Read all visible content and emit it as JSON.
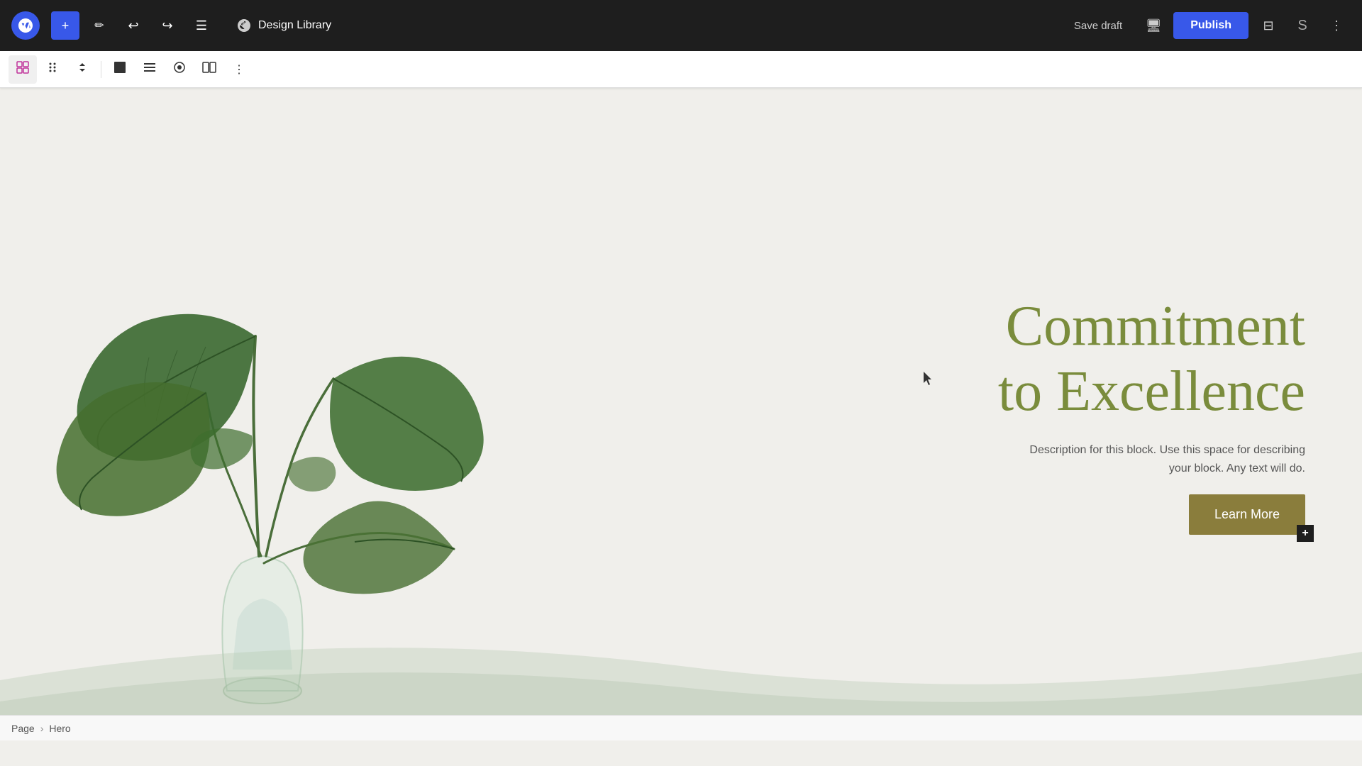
{
  "toolbar": {
    "add_label": "+",
    "pencil_label": "✏",
    "undo_label": "↩",
    "redo_label": "↪",
    "list_view_label": "☰",
    "design_library_label": "Design Library",
    "save_draft_label": "Save draft",
    "publish_label": "Publish"
  },
  "block_toolbar": {
    "grid_icon": "⊞",
    "drag_icon": "⠿",
    "arrows_icon": "⌃",
    "square_icon": "■",
    "align_icon": "≡",
    "circle_icon": "◉",
    "columns_icon": "⧉",
    "more_icon": "⋮"
  },
  "hero": {
    "title_line1": "Commitment",
    "title_line2": "to Excellence",
    "description": "Description for this block. Use this space for describing your block. Any text will do.",
    "cta_label": "Learn More",
    "cta_add_icon": "+"
  },
  "breadcrumb": {
    "page_label": "Page",
    "separator": "›",
    "section_label": "Hero"
  },
  "colors": {
    "title_color": "#7a8c3c",
    "cta_bg": "#8a7d3c",
    "toolbar_bg": "#1e1e1e",
    "publish_bg": "#3858e9",
    "canvas_bg": "#f0efeb"
  }
}
